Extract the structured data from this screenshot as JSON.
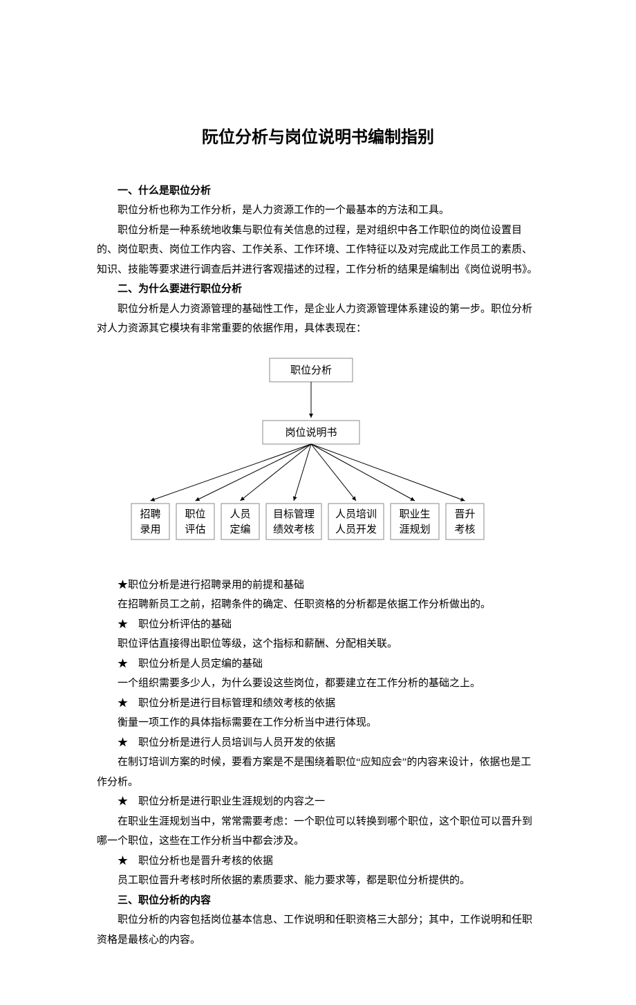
{
  "title": "阮位分析与岗位说明书编制指别",
  "s1": {
    "head": "一、什么是职位分析",
    "p1": "职位分析也称为工作分析，是人力资源工作的一个最基本的方法和工具。",
    "p2": "职位分析是一种系统地收集与职位有关信息的过程，是对组织中各工作职位的岗位设置目的、岗位职责、岗位工作内容、工作关系、工作环境、工作特征以及对完成此工作员工的素质、知识、技能等要求进行调查后并进行客观描述的过程，工作分析的结果是编制出《岗位说明书》。"
  },
  "s2": {
    "head": "二、为什么要进行职位分析",
    "p1": "职位分析是人力资源管理的基础性工作，是企业人力资源管理体系建设的第一步。职位分析对人力资源其它模块有非常重要的依据作用，具体表现在："
  },
  "diagram": {
    "top": "职位分析",
    "mid": "岗位说明书",
    "leaves": [
      {
        "l1": "招聘",
        "l2": "录用"
      },
      {
        "l1": "职位",
        "l2": "评估"
      },
      {
        "l1": "人员",
        "l2": "定编"
      },
      {
        "l1": "目标管理",
        "l2": "绩效考核"
      },
      {
        "l1": "人员培训",
        "l2": "人员开发"
      },
      {
        "l1": "职业生",
        "l2": "涯规划"
      },
      {
        "l1": "晋升",
        "l2": "考核"
      }
    ]
  },
  "stars": [
    {
      "head": "★职位分析是进行招聘录用的前提和基础",
      "body": "在招聘新员工之前，招聘条件的确定、任职资格的分析都是依据工作分析做出的。"
    },
    {
      "head": "★　职位分析评估的基础",
      "body": "职位评估直接得出职位等级，这个指标和薪酬、分配相关联。"
    },
    {
      "head": "★　职位分析是人员定编的基础",
      "body": "一个组织需要多少人，为什么要设这些岗位，都要建立在工作分析的基础之上。"
    },
    {
      "head": "★　职位分析是进行目标管理和绩效考核的依据",
      "body": "衡量一项工作的具体指标需要在工作分析当中进行体现。"
    },
    {
      "head": "★　职位分析是进行人员培训与人员开发的依据",
      "body": "在制订培训方案的时候，要看方案是不是围绕着职位“应知应会”的内容来设计，依据也是工作分析。"
    },
    {
      "head": "★　职位分析是进行职业生涯规划的内容之一",
      "body": "在职业生涯规划当中，常常需要考虑：一个职位可以转换到哪个职位，这个职位可以晋升到哪一个职位，这些在工作分析当中都会涉及。"
    },
    {
      "head": "★　职位分析也是晋升考核的依据",
      "body": "员工职位晋升考核时所依据的素质要求、能力要求等，都是职位分析提供的。"
    }
  ],
  "s3": {
    "head": "三、职位分析的内容",
    "p1": "职位分析的内容包括岗位基本信息、工作说明和任职资格三大部分；其中，工作说明和任职资格是最核心的内容。"
  }
}
